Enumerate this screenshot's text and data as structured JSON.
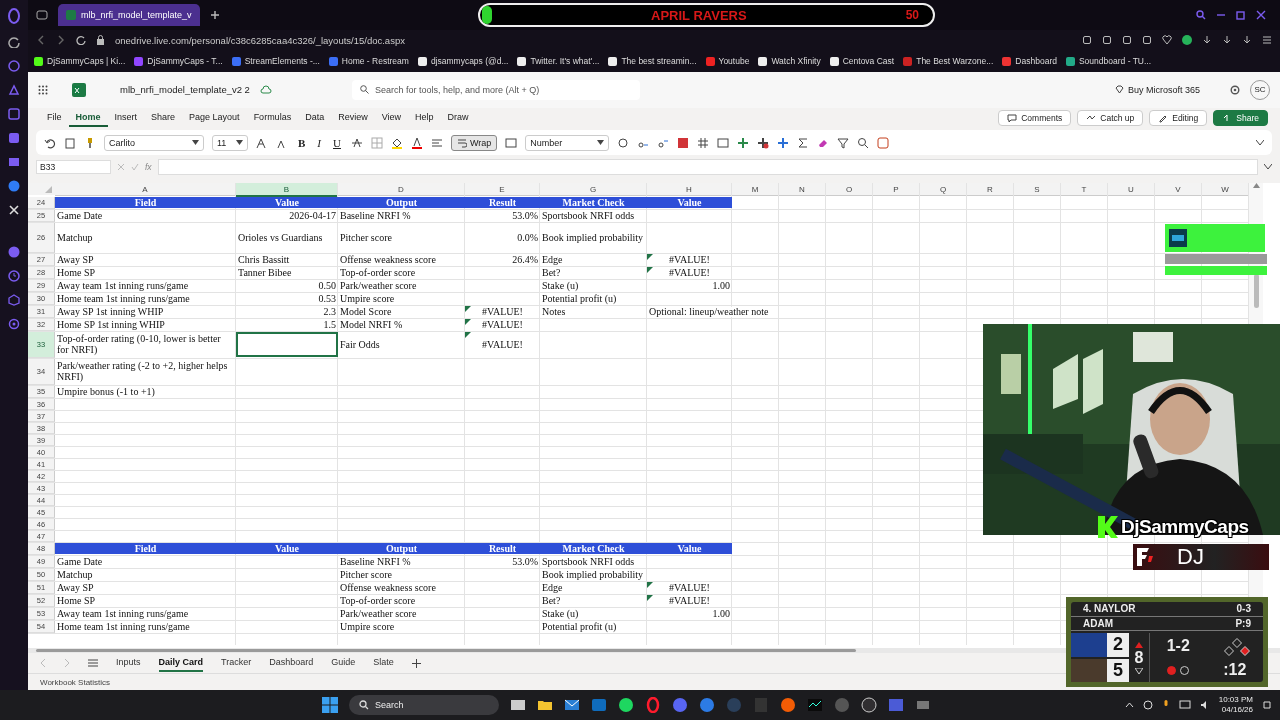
{
  "browser": {
    "tab_title": "mlb_nrfi_model_template_v",
    "url": "onedrive.live.com/personal/c38c6285caa4c326/_layouts/15/doc.aspx",
    "bookmarks": [
      "DjSammyCaps | Ki...",
      "DjSammyCaps - T...",
      "StreamElements -...",
      "Home - Restream",
      "djsammycaps (@d...",
      "Twitter. It's what'...",
      "The best streamin...",
      "Youtube",
      "Watch Xfinity",
      "Centova Cast",
      "The Best Warzone...",
      "Dashboard",
      "Soundboard - TU..."
    ]
  },
  "excel": {
    "file_name": "mlb_nrfi_model_template_v2 2",
    "search_placeholder": "Search for tools, help, and more (Alt + Q)",
    "buy_label": "Buy Microsoft 365",
    "avatar": "SC",
    "menu": [
      {
        "label": "File",
        "selected": false
      },
      {
        "label": "Home",
        "selected": true
      },
      {
        "label": "Insert",
        "selected": false
      },
      {
        "label": "Share",
        "selected": false
      },
      {
        "label": "Page Layout",
        "selected": false
      },
      {
        "label": "Formulas",
        "selected": false
      },
      {
        "label": "Data",
        "selected": false
      },
      {
        "label": "Review",
        "selected": false
      },
      {
        "label": "View",
        "selected": false
      },
      {
        "label": "Help",
        "selected": false
      },
      {
        "label": "Draw",
        "selected": false
      }
    ],
    "actions": [
      "Comments",
      "Catch up",
      "Editing",
      "Share"
    ],
    "toolbar": {
      "font": "Carlito",
      "size": "11",
      "format_buttons": [
        "B",
        "I",
        "U"
      ],
      "wrap": {
        "label": "Wrap",
        "on": true
      },
      "number_format": "Number"
    },
    "formula_bar": {
      "name_box": "B33",
      "fx": "fx"
    }
  },
  "sheet": {
    "columns": [
      {
        "label": "A",
        "selected": false
      },
      {
        "label": "B",
        "selected": true
      },
      {
        "label": "D",
        "selected": false
      },
      {
        "label": "E",
        "selected": false
      },
      {
        "label": "G",
        "selected": false
      },
      {
        "label": "H",
        "selected": false
      },
      {
        "label": "M",
        "selected": false
      },
      {
        "label": "N",
        "selected": false
      },
      {
        "label": "O",
        "selected": false
      },
      {
        "label": "P",
        "selected": false
      },
      {
        "label": "Q",
        "selected": false
      },
      {
        "label": "R",
        "selected": false
      },
      {
        "label": "S",
        "selected": false
      },
      {
        "label": "T",
        "selected": false
      },
      {
        "label": "U",
        "selected": false
      },
      {
        "label": "V",
        "selected": false
      },
      {
        "label": "W",
        "selected": false
      }
    ],
    "rows": [
      {
        "number": "24",
        "selected": false,
        "kind": "header",
        "cells": {
          "A": "Field",
          "B": "Value",
          "D": "Output",
          "E": "Result",
          "G": "Market Check",
          "H": "Value"
        }
      },
      {
        "number": "25",
        "selected": false,
        "cells": {
          "A": "Game Date",
          "B": {
            "text": "2026-04-17",
            "kind": "number"
          },
          "D": "Baseline NRFI %",
          "E": {
            "text": "53.0%",
            "kind": "number"
          },
          "G": "Sportsbook NRFI odds"
        }
      },
      {
        "number": "26",
        "selected": false,
        "cells": {
          "A": "Matchup",
          "B": "Orioles vs Guardians",
          "D": "Pitcher score",
          "E": {
            "text": "0.0%",
            "kind": "number"
          },
          "G": "Book implied probability"
        }
      },
      {
        "number": "27",
        "selected": false,
        "cells": {
          "A": "Away SP",
          "B": "Chris Bassitt",
          "D": "Offense weakness score",
          "E": {
            "text": "26.4%",
            "kind": "number"
          },
          "G": "Edge",
          "H": {
            "text": "#VALUE!",
            "kind": "error",
            "flagged": true
          }
        }
      },
      {
        "number": "28",
        "selected": false,
        "cells": {
          "A": "Home SP",
          "B": "Tanner Bibee",
          "D": "Top-of-order score",
          "G": "Bet?",
          "H": {
            "text": "#VALUE!",
            "kind": "error",
            "flagged": true
          }
        }
      },
      {
        "number": "29",
        "selected": false,
        "cells": {
          "A": "Away team 1st inning runs/game",
          "B": {
            "text": "0.50",
            "kind": "number"
          },
          "D": "Park/weather score",
          "G": "Stake (u)",
          "H": {
            "text": "1.00",
            "kind": "number"
          }
        }
      },
      {
        "number": "30",
        "selected": false,
        "cells": {
          "A": "Home team 1st inning runs/game",
          "B": {
            "text": "0.53",
            "kind": "number"
          },
          "D": "Umpire score",
          "G": "Potential profit (u)"
        }
      },
      {
        "number": "31",
        "selected": false,
        "cells": {
          "A": "Away SP 1st inning WHIP",
          "B": {
            "text": "2.3",
            "kind": "number"
          },
          "D": "Model Score",
          "E": {
            "text": "#VALUE!",
            "kind": "error",
            "flagged": true
          },
          "G": "Notes",
          "H": "Optional: lineup/weather note"
        }
      },
      {
        "number": "32",
        "selected": false,
        "cells": {
          "A": "Home SP 1st inning WHIP",
          "B": {
            "text": "1.5",
            "kind": "number"
          },
          "D": "Model NRFI %",
          "E": {
            "text": "#VALUE!",
            "kind": "error",
            "flagged": true
          }
        }
      },
      {
        "number": "33",
        "selected": true,
        "cells": {
          "A": "Top-of-order rating (0-10, lower is better for NRFI)",
          "B": {
            "selected": true
          },
          "D": "Fair Odds",
          "E": {
            "text": "#VALUE!",
            "kind": "error",
            "flagged": true
          }
        }
      },
      {
        "number": "34",
        "selected": false,
        "cells": {
          "A": "Park/weather rating (-2 to +2, higher helps NRFI)"
        }
      },
      {
        "number": "35",
        "selected": false,
        "cells": {
          "A": "Umpire bonus (-1 to +1)"
        }
      },
      {
        "number": "36",
        "selected": false
      },
      {
        "number": "37",
        "selected": false
      },
      {
        "number": "38",
        "selected": false
      },
      {
        "number": "39",
        "selected": false
      },
      {
        "number": "40",
        "selected": false
      },
      {
        "number": "41",
        "selected": false
      },
      {
        "number": "42",
        "selected": false
      },
      {
        "number": "43",
        "selected": false
      },
      {
        "number": "44",
        "selected": false
      },
      {
        "number": "45",
        "selected": false
      },
      {
        "number": "46",
        "selected": false
      },
      {
        "number": "47",
        "selected": false
      },
      {
        "number": "48",
        "selected": false,
        "kind": "header",
        "cells": {
          "A": "Field",
          "B": "Value",
          "D": "Output",
          "E": "Result",
          "G": "Market Check",
          "H": "Value"
        }
      },
      {
        "number": "49",
        "selected": false,
        "cells": {
          "A": "Game Date",
          "D": "Baseline NRFI %",
          "E": {
            "text": "53.0%",
            "kind": "number"
          },
          "G": "Sportsbook NRFI odds"
        }
      },
      {
        "number": "50",
        "selected": false,
        "cells": {
          "A": "Matchup",
          "D": "Pitcher score",
          "G": "Book implied probability"
        }
      },
      {
        "number": "51",
        "selected": false,
        "cells": {
          "A": "Away SP",
          "D": "Offense weakness score",
          "G": "Edge",
          "H": {
            "text": "#VALUE!",
            "kind": "error",
            "flagged": true
          }
        }
      },
      {
        "number": "52",
        "selected": false,
        "cells": {
          "A": "Home SP",
          "D": "Top-of-order score",
          "G": "Bet?",
          "H": {
            "text": "#VALUE!",
            "kind": "error",
            "flagged": true
          }
        }
      },
      {
        "number": "53",
        "selected": false,
        "cells": {
          "A": "Away team 1st inning runs/game",
          "D": "Park/weather score",
          "G": "Stake (u)",
          "H": {
            "text": "1.00",
            "kind": "number"
          }
        }
      },
      {
        "number": "54",
        "selected": false,
        "cells": {
          "A": "Home team 1st inning runs/game",
          "D": "Umpire score",
          "G": "Potential profit (u)"
        }
      }
    ],
    "tabs": [
      {
        "label": "Inputs",
        "selected": false
      },
      {
        "label": "Daily Card",
        "selected": true
      },
      {
        "label": "Tracker",
        "selected": false
      },
      {
        "label": "Dashboard",
        "selected": false
      },
      {
        "label": "Guide",
        "selected": false
      },
      {
        "label": "Slate",
        "selected": false
      }
    ],
    "status": "Workbook Statistics"
  },
  "taskbar": {
    "search": "Search",
    "time": "10:03 PM",
    "date": "04/16/26"
  },
  "stream": {
    "banner": {
      "title": "APRIL RAVERS",
      "count": "50"
    },
    "streamer": "DjSammyCaps",
    "sponsor": "DJ",
    "scoreboard": {
      "batter": "4. NAYLOR",
      "batter_line": "0-3",
      "pitcher": "ADAM",
      "pitch_count": "P:9",
      "teams": [
        {
          "score": "2",
          "color": "#1d3f8f"
        },
        {
          "score": "5",
          "color": "#4a3a2c"
        }
      ],
      "inning": "8",
      "top_half": true,
      "count": "1-2",
      "outs": [
        {
          "on": true
        },
        {
          "on": false
        }
      ],
      "bases": [
        {
          "on": true
        },
        {
          "on": false
        },
        {
          "on": false
        }
      ],
      "clock": ":12"
    }
  }
}
